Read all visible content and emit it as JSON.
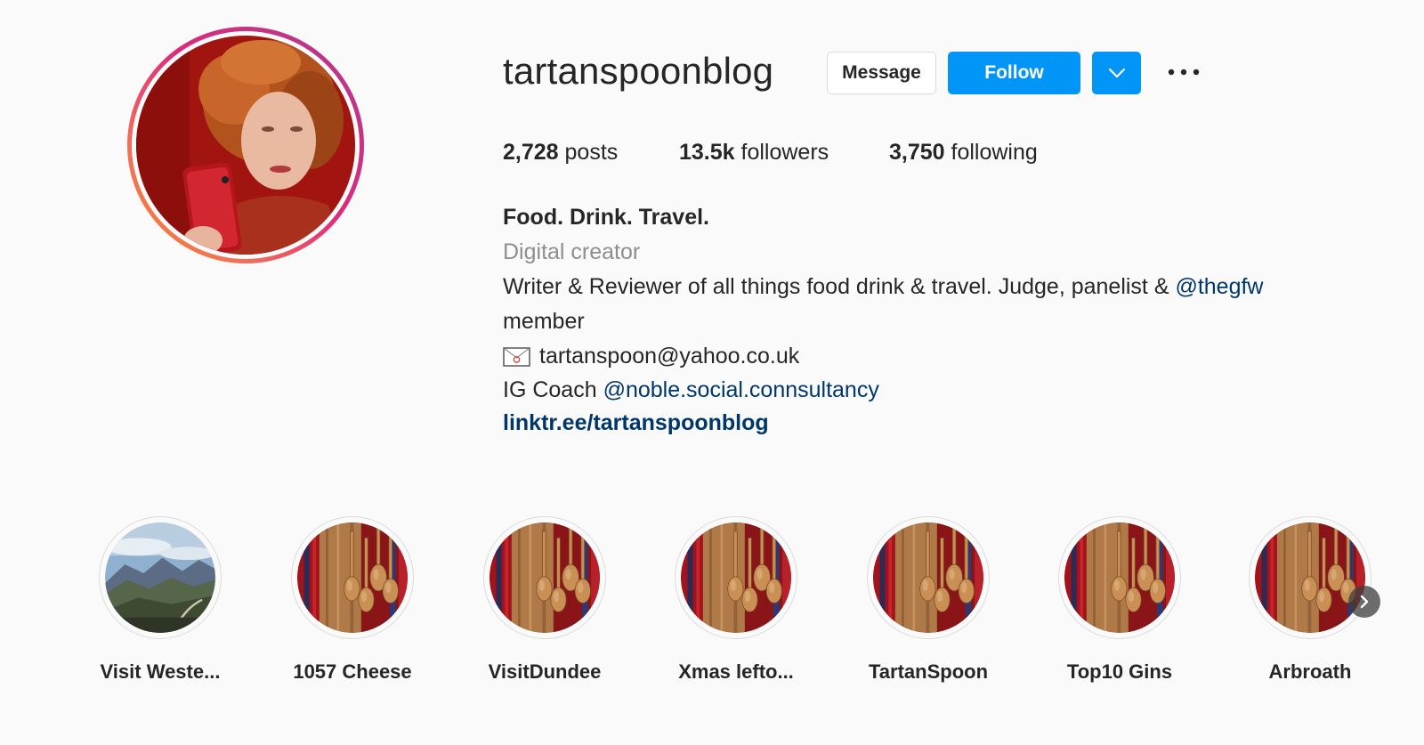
{
  "profile": {
    "username": "tartanspoonblog",
    "message_label": "Message",
    "follow_label": "Follow"
  },
  "stats": {
    "posts_count": "2,728",
    "posts_label": "posts",
    "followers_count": "13.5k",
    "followers_label": "followers",
    "following_count": "3,750",
    "following_label": "following"
  },
  "bio": {
    "title": "Food. Drink. Travel.",
    "category": "Digital creator",
    "line1_text": "Writer & Reviewer of all things food drink & travel. Judge, panelist & ",
    "line1_mention": "@thegfw",
    "line2_text": "member",
    "email": "tartanspoon@yahoo.co.uk",
    "coach_text": "IG Coach ",
    "coach_mention": "@noble.social.connsultancy",
    "link": "linktr.ee/tartanspoonblog"
  },
  "highlights": [
    {
      "label": "Visit Weste...",
      "image": "landscape"
    },
    {
      "label": "1057 Cheese",
      "image": "wooden-spoons"
    },
    {
      "label": "VisitDundee",
      "image": "wooden-spoons"
    },
    {
      "label": "Xmas lefto...",
      "image": "wooden-spoons"
    },
    {
      "label": "TartanSpoon",
      "image": "wooden-spoons"
    },
    {
      "label": "Top10 Gins",
      "image": "wooden-spoons"
    },
    {
      "label": "Arbroath",
      "image": "wooden-spoons"
    }
  ],
  "colors": {
    "follow_blue": "#0095f6",
    "link_blue": "#00376b",
    "text": "#262626",
    "muted": "#8e8e8e"
  },
  "icons": [
    "chevron-down-icon",
    "more-options-icon",
    "envelope-icon",
    "next-arrow-icon"
  ]
}
